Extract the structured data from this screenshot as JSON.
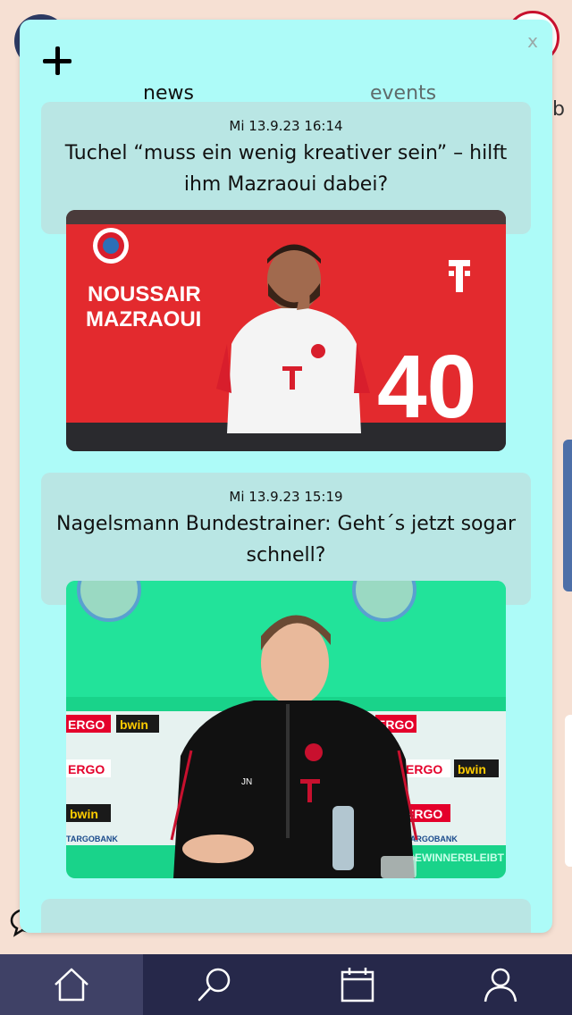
{
  "modal": {
    "close_label": "x",
    "tabs": [
      {
        "label": "news"
      },
      {
        "label": "events"
      }
    ],
    "active_tab": "news"
  },
  "news": [
    {
      "date": "Mi 13.9.23 16:14",
      "title": "Tuchel “muss ein wenig kreativer sein” – hilft ihm Mazraoui dabei?",
      "image_text": {
        "first_name": "NOUSSAIR",
        "last_name": "MAZRAOUI",
        "number": "40"
      }
    },
    {
      "date": "Mi 13.9.23 15:19",
      "title": "Nagelsmann Bundestrainer: Geht´s jetzt sogar schnell?",
      "image_text": {
        "sponsor_1": "ERGO",
        "sponsor_2": "bwin",
        "sponsor_3": "TARGOBANK",
        "backdrop_hashtag": "#GEWINNERBLEIBT",
        "initials": "JN"
      }
    }
  ],
  "nav": {
    "items": [
      "home-icon",
      "search-icon",
      "calendar-icon",
      "profile-icon"
    ],
    "active": "home-icon"
  },
  "colors": {
    "modal_bg": "#adfbf8",
    "card_bg": "#b9e6e4",
    "nav_bg": "#26284a",
    "nav_active_bg": "#3f4166",
    "page_bg": "#f6e0d3"
  }
}
